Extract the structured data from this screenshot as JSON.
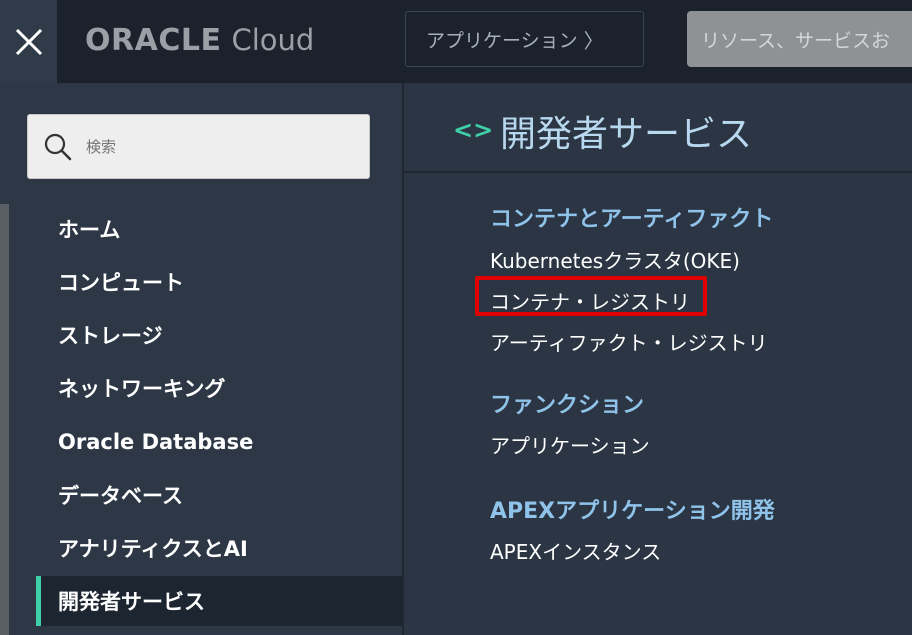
{
  "topbar": {
    "close_label": "✕",
    "logo_oracle": "ORACLE",
    "logo_cloud": "Cloud",
    "app_button_label": "アプリケーション",
    "app_button_chevron": "〉",
    "search_placeholder": "リソース、サービスお"
  },
  "leftnav": {
    "search_placeholder": "検索",
    "items": [
      {
        "label": "ホーム"
      },
      {
        "label": "コンピュート"
      },
      {
        "label": "ストレージ"
      },
      {
        "label": "ネットワーキング"
      },
      {
        "label": "Oracle Database"
      },
      {
        "label": "データベース"
      },
      {
        "label": "アナリティクスとAI"
      },
      {
        "label": "開発者サービス"
      }
    ],
    "active_item": "開発者サービス"
  },
  "rightpane": {
    "icon": "code-icon",
    "title": "開発者サービス",
    "groups": [
      {
        "title": "コンテナとアーティファクト",
        "links": [
          "Kubernetesクラスタ(OKE)",
          "コンテナ・レジストリ",
          "アーティファクト・レジストリ"
        ]
      },
      {
        "title": "ファンクション",
        "links": [
          "アプリケーション"
        ]
      },
      {
        "title": "APEXアプリケーション開発",
        "links": [
          "APEXインスタンス"
        ]
      }
    ],
    "highlighted_link": "コンテナ・レジストリ"
  },
  "colors": {
    "accent": "#3fd0a8",
    "group_title": "#8fc3ea",
    "highlight_box": "#e00000",
    "topbar_bg": "#1b222c",
    "nav_bg": "#2d3746"
  }
}
